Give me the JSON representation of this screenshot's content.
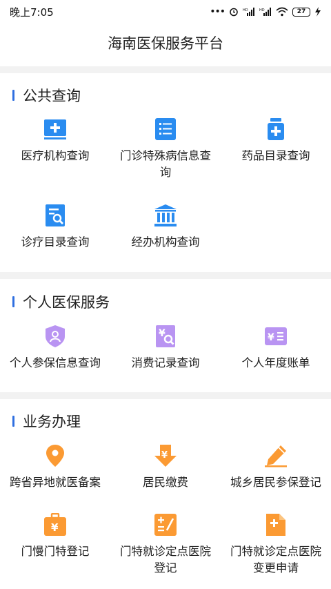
{
  "status_bar": {
    "time": "晚上7:05",
    "dots": "•••",
    "battery": "27"
  },
  "header": {
    "title": "海南医保服务平台"
  },
  "sections": [
    {
      "title": "公共查询",
      "items": [
        {
          "label": "医疗机构查询",
          "icon": "medical-kit-icon"
        },
        {
          "label": "门诊特殊病信息查询",
          "icon": "list-icon"
        },
        {
          "label": "药品目录查询",
          "icon": "medicine-bottle-icon"
        },
        {
          "label": "诊疗目录查询",
          "icon": "document-search-icon"
        },
        {
          "label": "经办机构查询",
          "icon": "institution-building-icon"
        }
      ]
    },
    {
      "title": "个人医保服务",
      "items": [
        {
          "label": "个人参保信息查询",
          "icon": "shield-user-icon"
        },
        {
          "label": "消费记录查询",
          "icon": "yuan-search-icon"
        },
        {
          "label": "个人年度账单",
          "icon": "yuan-bill-icon"
        }
      ]
    },
    {
      "title": "业务办理",
      "items": [
        {
          "label": "跨省异地就医备案",
          "icon": "location-pin-icon"
        },
        {
          "label": "居民缴费",
          "icon": "yuan-download-icon"
        },
        {
          "label": "城乡居民参保登记",
          "icon": "edit-pen-icon"
        },
        {
          "label": "门慢门特登记",
          "icon": "yuan-briefcase-icon"
        },
        {
          "label": "门特就诊定点医院登记",
          "icon": "calculator-icon"
        },
        {
          "label": "门特就诊定点医院变更申请",
          "icon": "document-plus-icon"
        }
      ]
    }
  ],
  "colors": {
    "blue": "#2a8cf0",
    "purple": "#b994f2",
    "orange": "#fb9a33",
    "accent_bar": "#2f6fe0",
    "divider": "#f2f2f2"
  }
}
